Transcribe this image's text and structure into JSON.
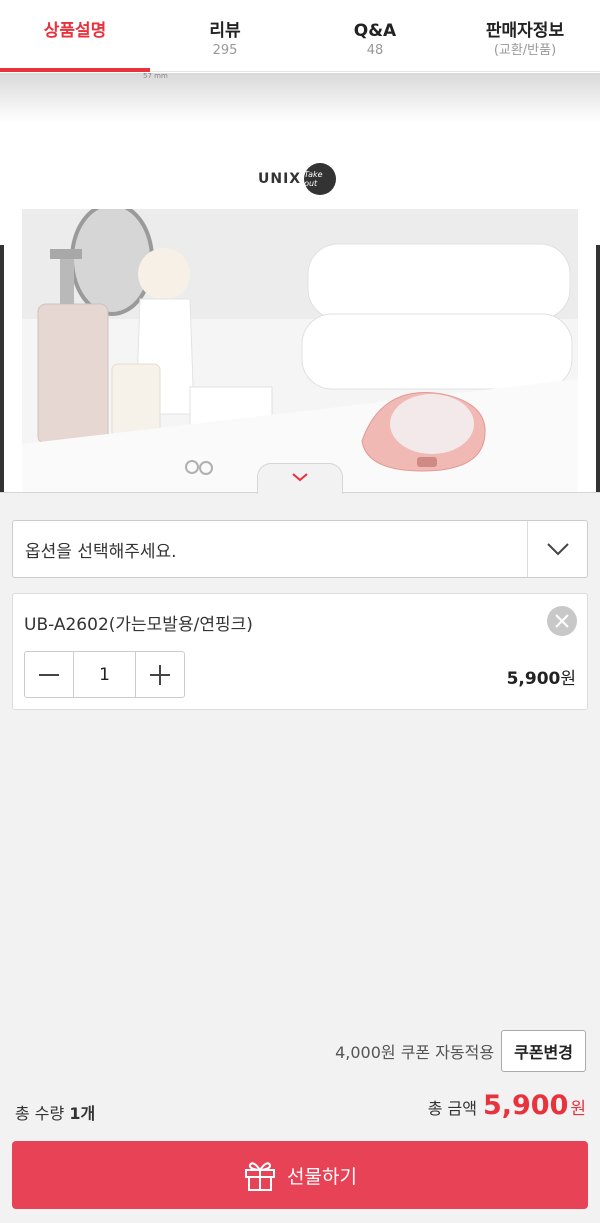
{
  "tabs": [
    {
      "label": "상품설명",
      "sub": ""
    },
    {
      "label": "리뷰",
      "sub": "295"
    },
    {
      "label": "Q&A",
      "sub": "48"
    },
    {
      "label": "판매자정보",
      "sub": "(교환/반품)"
    }
  ],
  "ruler_text": "57 mm",
  "brand": {
    "name": "UNIX",
    "badge": "Take out"
  },
  "option_select": {
    "placeholder": "옵션을 선택해주세요."
  },
  "selected_option": {
    "name": "UB-A2602(가는모발용/연핑크)",
    "quantity": "1",
    "price_amount": "5,900",
    "price_unit": "원"
  },
  "coupon": {
    "text": "4,000원 쿠폰 자동적용",
    "button_label": "쿠폰변경"
  },
  "totals": {
    "quantity_label": "총 수량",
    "quantity_value": "1개",
    "amount_label": "총 금액",
    "amount_value": "5,900",
    "amount_unit": "원"
  },
  "gift_button": {
    "label": "선물하기"
  },
  "colors": {
    "accent": "#e8323c",
    "gift_button": "#e84257"
  }
}
